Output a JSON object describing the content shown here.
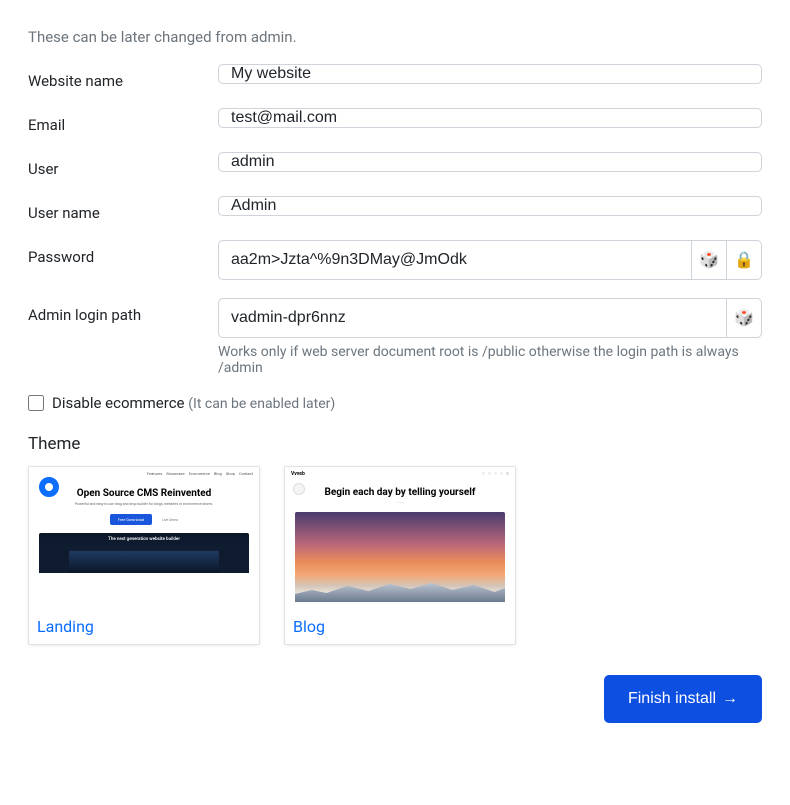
{
  "hint": "These can be later changed from admin.",
  "fields": {
    "website_name": {
      "label": "Website name",
      "value": "My website"
    },
    "email": {
      "label": "Email",
      "value": "test@mail.com"
    },
    "user": {
      "label": "User",
      "value": "admin"
    },
    "user_name": {
      "label": "User name",
      "value": "Admin"
    },
    "password": {
      "label": "Password",
      "value": "aa2m>Jzta^%9n3DMay@JmOdk"
    },
    "admin_login_path": {
      "label": "Admin login path",
      "value": "vadmin-dpr6nnz",
      "help": "Works only if web server document root is /public otherwise the login path is always /admin"
    }
  },
  "icons": {
    "dice": "🎲",
    "lock": "🔒"
  },
  "disable_ecommerce": {
    "label": "Disable ecommerce",
    "hint": "(It can be enabled later)"
  },
  "theme": {
    "heading": "Theme",
    "options": {
      "landing": {
        "label": "Landing",
        "preview": {
          "title": "Open Source CMS Reinvented",
          "subtitle": "Powerful and easy to use drag and drop builder for blogs, websites or ecommerce stores.",
          "button": "Free Download",
          "link": "Live Demo",
          "dark_title": "The next generation website builder"
        }
      },
      "blog": {
        "label": "Blog",
        "preview": {
          "brand": "Vvveb",
          "title": "Begin each day by telling yourself"
        }
      }
    }
  },
  "submit": {
    "label": "Finish install",
    "arrow": "→"
  }
}
